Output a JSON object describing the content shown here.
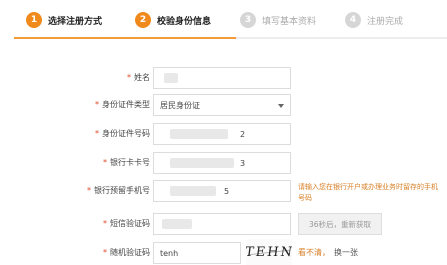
{
  "steps": [
    {
      "number": "1",
      "label": "选择注册方式",
      "state": "done"
    },
    {
      "number": "2",
      "label": "校验身份信息",
      "state": "active"
    },
    {
      "number": "3",
      "label": "填写基本资料",
      "state": "pending"
    },
    {
      "number": "4",
      "label": "注册完成",
      "state": "pending"
    }
  ],
  "form": {
    "name": {
      "label": "姓名",
      "value_tail": ""
    },
    "id_type": {
      "label": "身份证件类型",
      "value": "居民身份证"
    },
    "id_number": {
      "label": "身份证件号码",
      "value_tail": "2"
    },
    "card_number": {
      "label": "银行卡卡号",
      "value_tail": "3"
    },
    "phone": {
      "label": "银行预留手机号",
      "value_tail": "5",
      "hint": "请输入您在银行开户或办理业务时留存的手机号码"
    },
    "sms": {
      "label": "短信验证码",
      "button": "36秒后，重新获取"
    },
    "captcha": {
      "label": "随机验证码",
      "value": "tenh",
      "image_text": "TEHN",
      "hint": "看不清，",
      "refresh": "换一张"
    }
  },
  "colors": {
    "accent": "#f08a1c",
    "required": "#e0462a",
    "hint": "#d97f25"
  }
}
